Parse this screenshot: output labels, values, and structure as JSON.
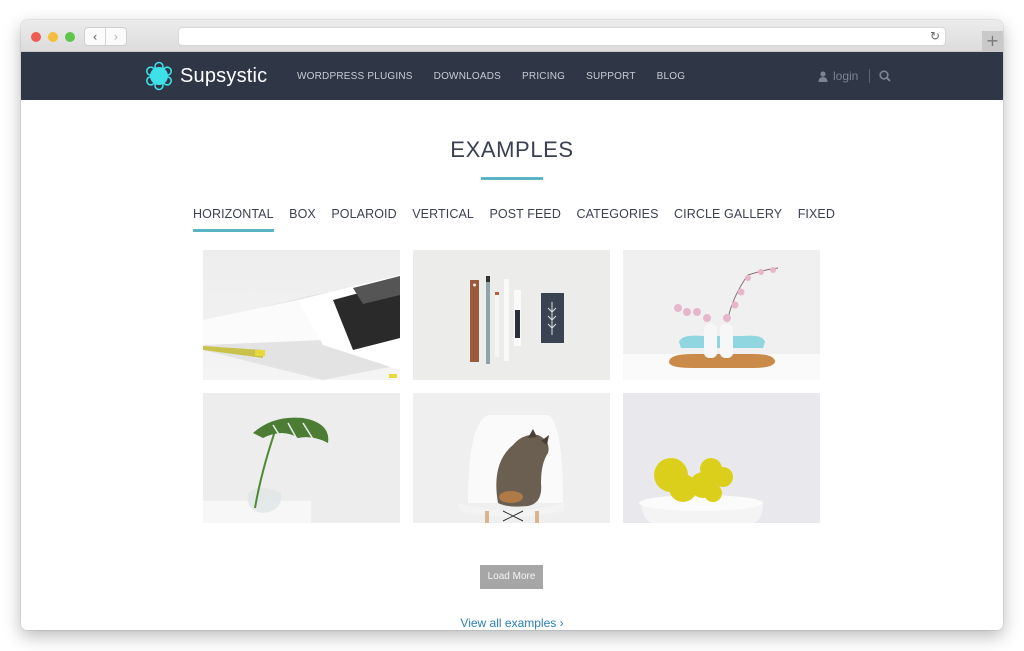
{
  "browser": {
    "back_glyph": "‹",
    "forward_glyph": "›",
    "reload_glyph": "↻",
    "newtab_glyph": "+",
    "address": ""
  },
  "site": {
    "brand": "Supsystic",
    "brand_color": "#3ee0ea",
    "nav_bg": "#2f3646",
    "menu": [
      "WORDPRESS PLUGINS",
      "DOWNLOADS",
      "PRICING",
      "SUPPORT",
      "BLOG"
    ],
    "login_label": "login",
    "icons": {
      "user": "user-icon",
      "search": "search-icon"
    }
  },
  "main": {
    "title": "EXAMPLES",
    "accent": "#5ab5c2",
    "tabs": [
      {
        "label": "HORIZONTAL",
        "active": true
      },
      {
        "label": "BOX",
        "active": false
      },
      {
        "label": "POLAROID",
        "active": false
      },
      {
        "label": "VERTICAL",
        "active": false
      },
      {
        "label": "POST FEED",
        "active": false
      },
      {
        "label": "CATEGORIES",
        "active": false
      },
      {
        "label": "CIRCLE GALLERY",
        "active": false
      },
      {
        "label": "FIXED",
        "active": false
      }
    ],
    "gallery": [
      {
        "subject": "open photo book"
      },
      {
        "subject": "ruler, pencils and marker flat lay"
      },
      {
        "subject": "white vases with cherry blossoms"
      },
      {
        "subject": "monstera leaf in glass vase"
      },
      {
        "subject": "tabby cat on white chair"
      },
      {
        "subject": "yellow cactus in white pot"
      }
    ],
    "load_more_label": "Load More",
    "view_all_label": "View all examples ›"
  }
}
